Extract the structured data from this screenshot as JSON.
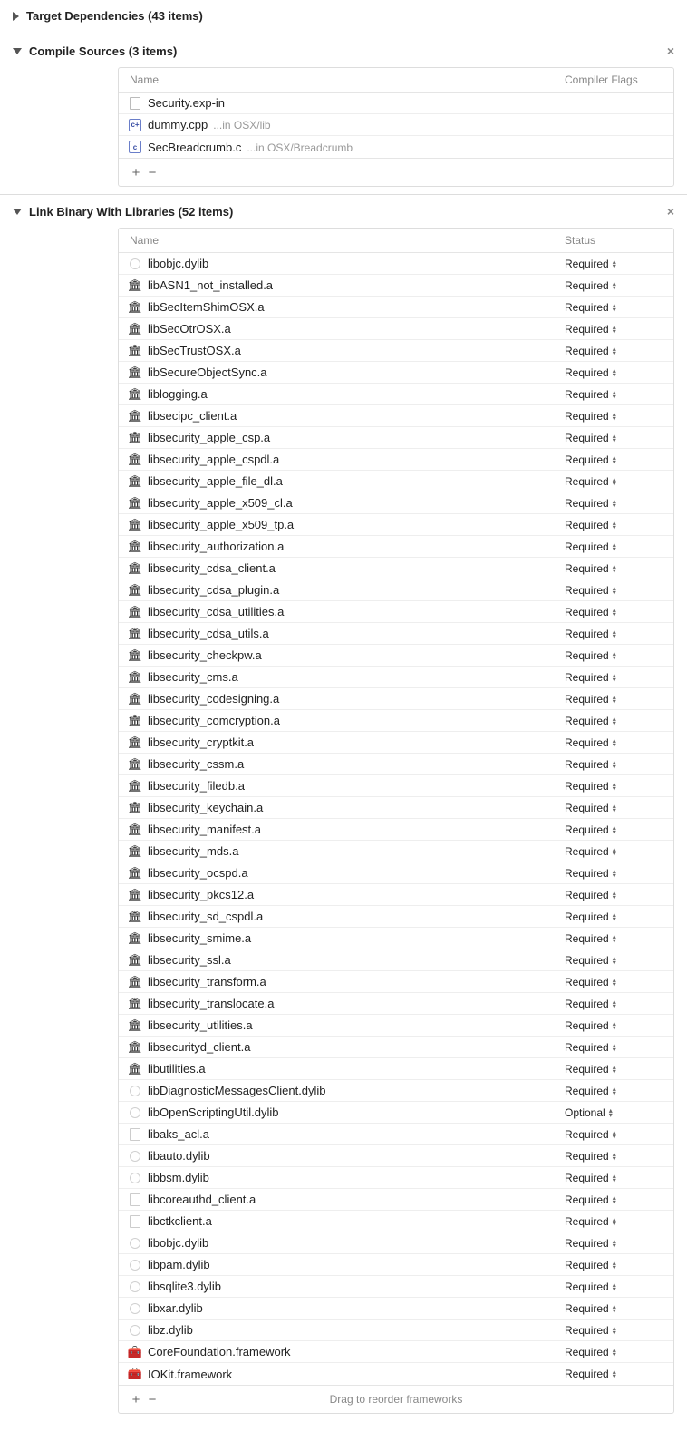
{
  "sections": {
    "target_deps": {
      "title": "Target Dependencies (43 items)"
    },
    "compile_sources": {
      "title": "Compile Sources (3 items)",
      "columns": {
        "name": "Name",
        "flags": "Compiler Flags"
      },
      "rows": [
        {
          "icon": "file",
          "name": "Security.exp-in",
          "path": ""
        },
        {
          "icon": "cpp",
          "name": "dummy.cpp",
          "path": "...in OSX/lib"
        },
        {
          "icon": "c",
          "name": "SecBreadcrumb.c",
          "path": "...in OSX/Breadcrumb"
        }
      ]
    },
    "link_binary": {
      "title": "Link Binary With Libraries (52 items)",
      "columns": {
        "name": "Name",
        "status": "Status"
      },
      "footer_hint": "Drag to reorder frameworks",
      "rows": [
        {
          "icon": "dylib",
          "name": "libobjc.dylib",
          "status": "Required"
        },
        {
          "icon": "lib",
          "name": "libASN1_not_installed.a",
          "status": "Required"
        },
        {
          "icon": "lib",
          "name": "libSecItemShimOSX.a",
          "status": "Required"
        },
        {
          "icon": "lib",
          "name": "libSecOtrOSX.a",
          "status": "Required"
        },
        {
          "icon": "lib",
          "name": "libSecTrustOSX.a",
          "status": "Required"
        },
        {
          "icon": "lib",
          "name": "libSecureObjectSync.a",
          "status": "Required"
        },
        {
          "icon": "lib",
          "name": "liblogging.a",
          "status": "Required"
        },
        {
          "icon": "lib",
          "name": "libsecipc_client.a",
          "status": "Required"
        },
        {
          "icon": "lib",
          "name": "libsecurity_apple_csp.a",
          "status": "Required"
        },
        {
          "icon": "lib",
          "name": "libsecurity_apple_cspdl.a",
          "status": "Required"
        },
        {
          "icon": "lib",
          "name": "libsecurity_apple_file_dl.a",
          "status": "Required"
        },
        {
          "icon": "lib",
          "name": "libsecurity_apple_x509_cl.a",
          "status": "Required"
        },
        {
          "icon": "lib",
          "name": "libsecurity_apple_x509_tp.a",
          "status": "Required"
        },
        {
          "icon": "lib",
          "name": "libsecurity_authorization.a",
          "status": "Required"
        },
        {
          "icon": "lib",
          "name": "libsecurity_cdsa_client.a",
          "status": "Required"
        },
        {
          "icon": "lib",
          "name": "libsecurity_cdsa_plugin.a",
          "status": "Required"
        },
        {
          "icon": "lib",
          "name": "libsecurity_cdsa_utilities.a",
          "status": "Required"
        },
        {
          "icon": "lib",
          "name": "libsecurity_cdsa_utils.a",
          "status": "Required"
        },
        {
          "icon": "lib",
          "name": "libsecurity_checkpw.a",
          "status": "Required"
        },
        {
          "icon": "lib",
          "name": "libsecurity_cms.a",
          "status": "Required"
        },
        {
          "icon": "lib",
          "name": "libsecurity_codesigning.a",
          "status": "Required"
        },
        {
          "icon": "lib",
          "name": "libsecurity_comcryption.a",
          "status": "Required"
        },
        {
          "icon": "lib",
          "name": "libsecurity_cryptkit.a",
          "status": "Required"
        },
        {
          "icon": "lib",
          "name": "libsecurity_cssm.a",
          "status": "Required"
        },
        {
          "icon": "lib",
          "name": "libsecurity_filedb.a",
          "status": "Required"
        },
        {
          "icon": "lib",
          "name": "libsecurity_keychain.a",
          "status": "Required"
        },
        {
          "icon": "lib",
          "name": "libsecurity_manifest.a",
          "status": "Required"
        },
        {
          "icon": "lib",
          "name": "libsecurity_mds.a",
          "status": "Required"
        },
        {
          "icon": "lib",
          "name": "libsecurity_ocspd.a",
          "status": "Required"
        },
        {
          "icon": "lib",
          "name": "libsecurity_pkcs12.a",
          "status": "Required"
        },
        {
          "icon": "lib",
          "name": "libsecurity_sd_cspdl.a",
          "status": "Required"
        },
        {
          "icon": "lib",
          "name": "libsecurity_smime.a",
          "status": "Required"
        },
        {
          "icon": "lib",
          "name": "libsecurity_ssl.a",
          "status": "Required"
        },
        {
          "icon": "lib",
          "name": "libsecurity_transform.a",
          "status": "Required"
        },
        {
          "icon": "lib",
          "name": "libsecurity_translocate.a",
          "status": "Required"
        },
        {
          "icon": "lib",
          "name": "libsecurity_utilities.a",
          "status": "Required"
        },
        {
          "icon": "lib",
          "name": "libsecurityd_client.a",
          "status": "Required"
        },
        {
          "icon": "lib",
          "name": "libutilities.a",
          "status": "Required"
        },
        {
          "icon": "dylib",
          "name": "libDiagnosticMessagesClient.dylib",
          "status": "Required"
        },
        {
          "icon": "dylib",
          "name": "libOpenScriptingUtil.dylib",
          "status": "Optional"
        },
        {
          "icon": "a",
          "name": "libaks_acl.a",
          "status": "Required"
        },
        {
          "icon": "dylib",
          "name": "libauto.dylib",
          "status": "Required"
        },
        {
          "icon": "dylib",
          "name": "libbsm.dylib",
          "status": "Required"
        },
        {
          "icon": "a",
          "name": "libcoreauthd_client.a",
          "status": "Required"
        },
        {
          "icon": "a",
          "name": "libctkclient.a",
          "status": "Required"
        },
        {
          "icon": "dylib",
          "name": "libobjc.dylib",
          "status": "Required"
        },
        {
          "icon": "dylib",
          "name": "libpam.dylib",
          "status": "Required"
        },
        {
          "icon": "dylib",
          "name": "libsqlite3.dylib",
          "status": "Required"
        },
        {
          "icon": "dylib",
          "name": "libxar.dylib",
          "status": "Required"
        },
        {
          "icon": "dylib",
          "name": "libz.dylib",
          "status": "Required"
        },
        {
          "icon": "fw",
          "name": "CoreFoundation.framework",
          "status": "Required"
        },
        {
          "icon": "fw",
          "name": "IOKit.framework",
          "status": "Required"
        }
      ]
    }
  }
}
